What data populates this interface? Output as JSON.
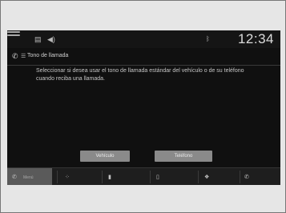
{
  "status_bar": {
    "clock": "12:34",
    "bt_label": "",
    "icons": [
      "home-icon",
      "grid-icon",
      "speaker-icon",
      "bluetooth-icon"
    ]
  },
  "title": "Tono de llamada",
  "body": "Seleccionar si desea usar el tono de llamada estándar del vehículo o de su teléfono cuando reciba una llamada.",
  "buttons": {
    "vehicle": "Vehículo",
    "phone": "Teléfono"
  },
  "tabs": [
    {
      "label": "Menú",
      "icon": "phone-icon"
    },
    {
      "label": "",
      "icon": "grid-icon"
    },
    {
      "label": "",
      "icon": "contacts-icon"
    },
    {
      "label": "",
      "icon": "device-icon"
    },
    {
      "label": "",
      "icon": "settings-icon"
    },
    {
      "label": "",
      "icon": "phone-ring-icon"
    }
  ],
  "colors": {
    "screen_bg": "#101010",
    "button_bg": "#8a8a8a",
    "active_tab": "#5a5a5a"
  }
}
